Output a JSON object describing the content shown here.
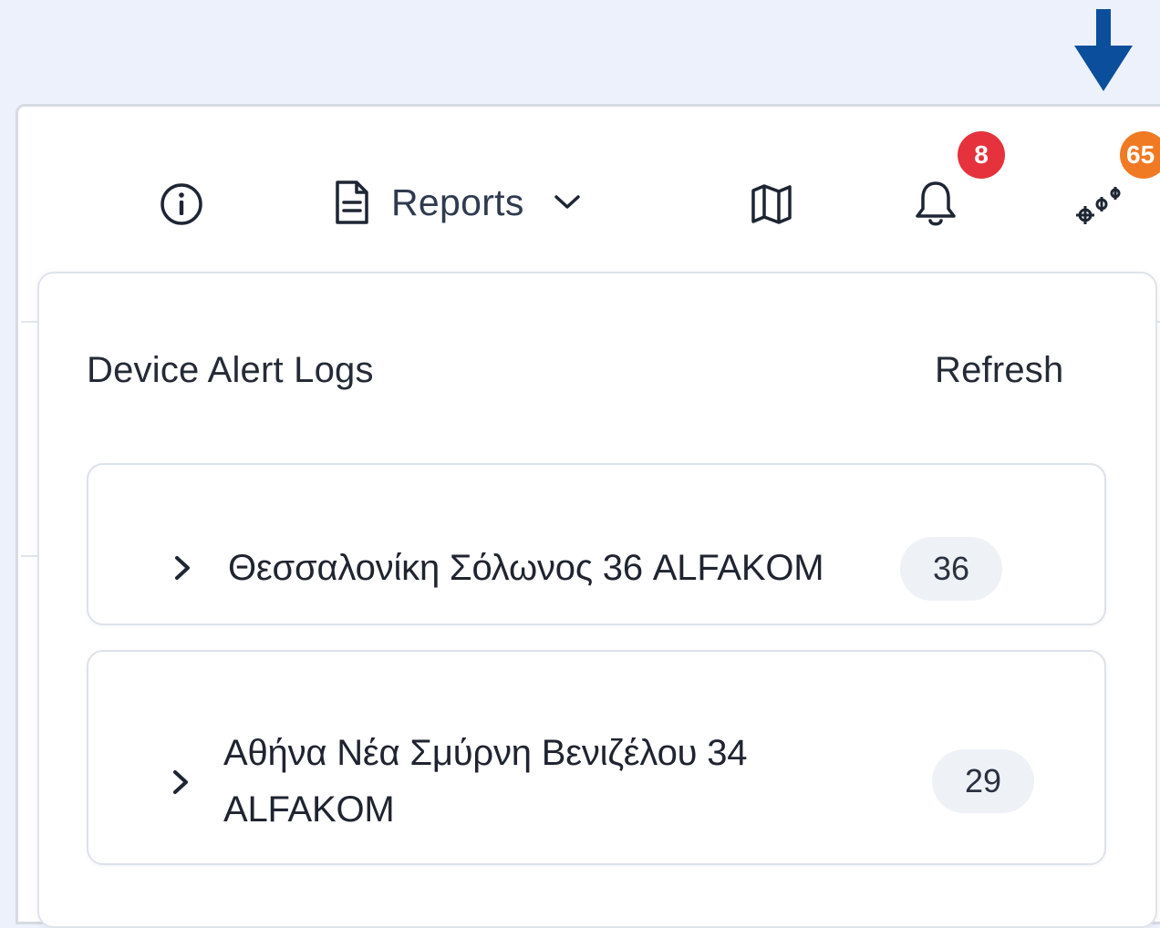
{
  "navbar": {
    "reports_label": "Reports",
    "notifications_badge": "8",
    "devices_badge": "65"
  },
  "panel": {
    "title": "Device Alert Logs",
    "refresh_label": "Refresh",
    "groups": [
      {
        "name": "Θεσσαλονίκη Σόλωνος 36 ALFAKOM",
        "count": "36"
      },
      {
        "name": "Αθήνα Νέα Σμύρνη Βενιζέλου 34 ALFAKOM",
        "count": "29"
      }
    ]
  },
  "colors": {
    "pointer_arrow": "#0b4f9c",
    "notifications_badge": "#e5323c",
    "devices_badge": "#f07a24",
    "page_background": "#ecf1fb"
  },
  "icons": [
    "arrow-down-icon",
    "info-icon",
    "document-icon",
    "chevron-down-icon",
    "map-icon",
    "bell-icon",
    "devices-icon",
    "chevron-right-icon"
  ]
}
